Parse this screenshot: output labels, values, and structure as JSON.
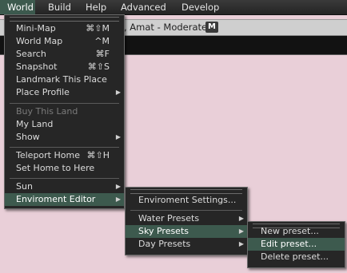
{
  "menubar": {
    "items": [
      "World",
      "Build",
      "Help",
      "Advanced",
      "Develop"
    ]
  },
  "location": {
    "text": ", Amat - Moderate",
    "badge": "M"
  },
  "world_menu": {
    "items": [
      {
        "label": "Mini-Map",
        "shortcut": "⌘⇧M"
      },
      {
        "label": "World Map",
        "shortcut": "^M"
      },
      {
        "label": "Search",
        "shortcut": "⌘F"
      },
      {
        "label": "Snapshot",
        "shortcut": "⌘⇧S"
      },
      {
        "label": "Landmark This Place"
      },
      {
        "label": "Place Profile",
        "submenu_arrow": "▶"
      },
      {
        "label": "Buy This Land",
        "disabled": true
      },
      {
        "label": "My Land"
      },
      {
        "label": "Show",
        "submenu_arrow": "▶"
      },
      {
        "label": "Teleport Home",
        "shortcut": "⌘⇧H"
      },
      {
        "label": "Set Home to Here"
      },
      {
        "label": "Sun",
        "submenu_arrow": "▶"
      },
      {
        "label": "Enviroment Editor",
        "submenu_arrow": "▶",
        "highlighted": true
      }
    ]
  },
  "env_menu": {
    "items": [
      {
        "label": "Enviroment Settings..."
      },
      {
        "label": "Water Presets",
        "submenu_arrow": "▶"
      },
      {
        "label": "Sky Presets",
        "submenu_arrow": "▶",
        "highlighted": true
      },
      {
        "label": "Day Presets",
        "submenu_arrow": "▶"
      }
    ]
  },
  "sky_menu": {
    "items": [
      {
        "label": "New preset..."
      },
      {
        "label": "Edit preset...",
        "highlighted": true
      },
      {
        "label": "Delete preset..."
      }
    ]
  },
  "colors": {
    "menu_bg": "#262626",
    "highlight": "#3d5a4e",
    "viewport_bg": "#e9cfd8"
  }
}
